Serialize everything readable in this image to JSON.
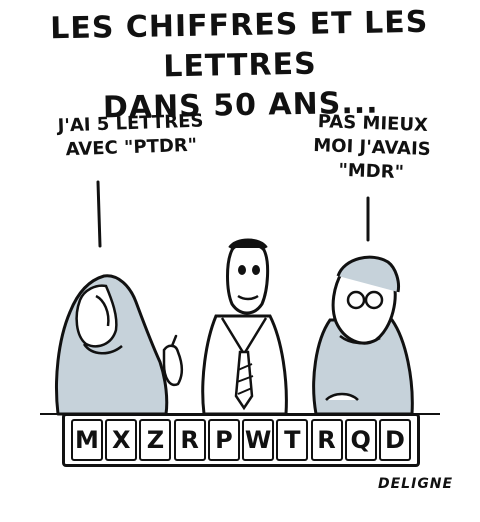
{
  "title": {
    "line1": "LES CHIFFRES ET LES LETTRES",
    "line2": "DANS 50 ANS..."
  },
  "speech_left": {
    "line1": "J'AI 5 LETTRES",
    "line2": "AVEC \"PTDR\""
  },
  "speech_right": {
    "line1": "PAS MIEUX",
    "line2": "MOI J'AVAIS",
    "line3": "\"MDR\""
  },
  "letters": [
    "M",
    "X",
    "Z",
    "R",
    "P",
    "W",
    "T",
    "R",
    "Q",
    "D"
  ],
  "signature": "DELIGNE",
  "colors": {
    "ink": "#111111",
    "shade": "#c6d2da",
    "paper": "#ffffff"
  }
}
